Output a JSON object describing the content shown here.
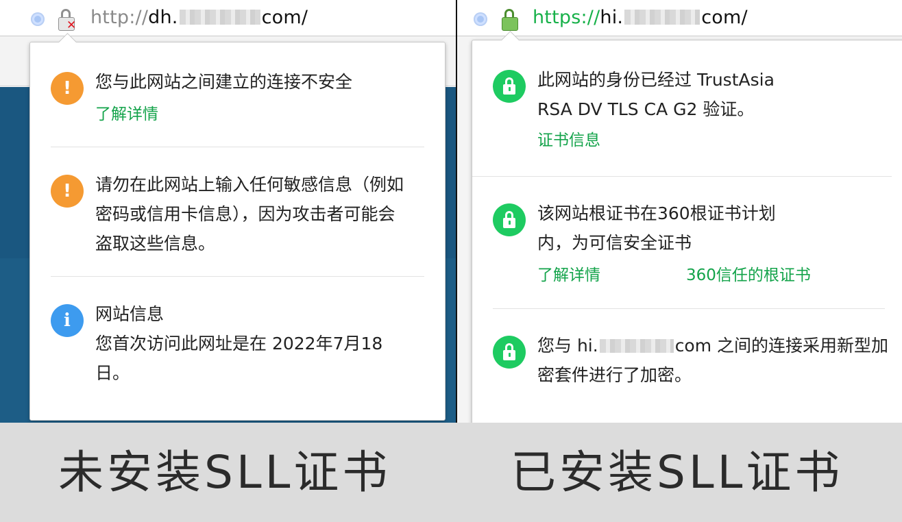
{
  "left": {
    "url": {
      "scheme": "http://",
      "host_start": "dh.",
      "host_end": "com/"
    },
    "popup": {
      "warning1": {
        "text": "您与此网站之间建立的连接不安全",
        "link": "了解详情"
      },
      "warning2": {
        "text": "请勿在此网站上输入任何敏感信息（例如密码或信用卡信息），因为攻击者可能会盗取这些信息。"
      },
      "info": {
        "title": "网站信息",
        "text": "您首次访问此网址是在 2022年7月18日。"
      }
    },
    "caption": "未安装SLL证书"
  },
  "right": {
    "url": {
      "scheme": "https://",
      "host_start": "hi.",
      "host_end": "com/"
    },
    "popup": {
      "identity": {
        "text": "此网站的身份已经过 TrustAsia RSA DV TLS CA G2 验证。",
        "link": "证书信息"
      },
      "root": {
        "text": "该网站根证书在360根证书计划内，为可信安全证书",
        "link1": "了解详情",
        "link2": "360信任的根证书"
      },
      "encryption": {
        "text_start": "您与 hi.",
        "text_end": "com 之间的连接采用新型加密套件进行了加密。"
      }
    },
    "caption": "已安装SLL证书"
  },
  "colors": {
    "secure_green": "#1ecb61",
    "link_green": "#13a34a",
    "warning_orange": "#f59a32",
    "info_blue": "#3d9bef",
    "error_red": "#e0141e"
  },
  "icons": [
    "radio-icon",
    "insecure-lock-icon",
    "secure-lock-icon",
    "warning-icon",
    "info-icon",
    "lock-icon"
  ]
}
